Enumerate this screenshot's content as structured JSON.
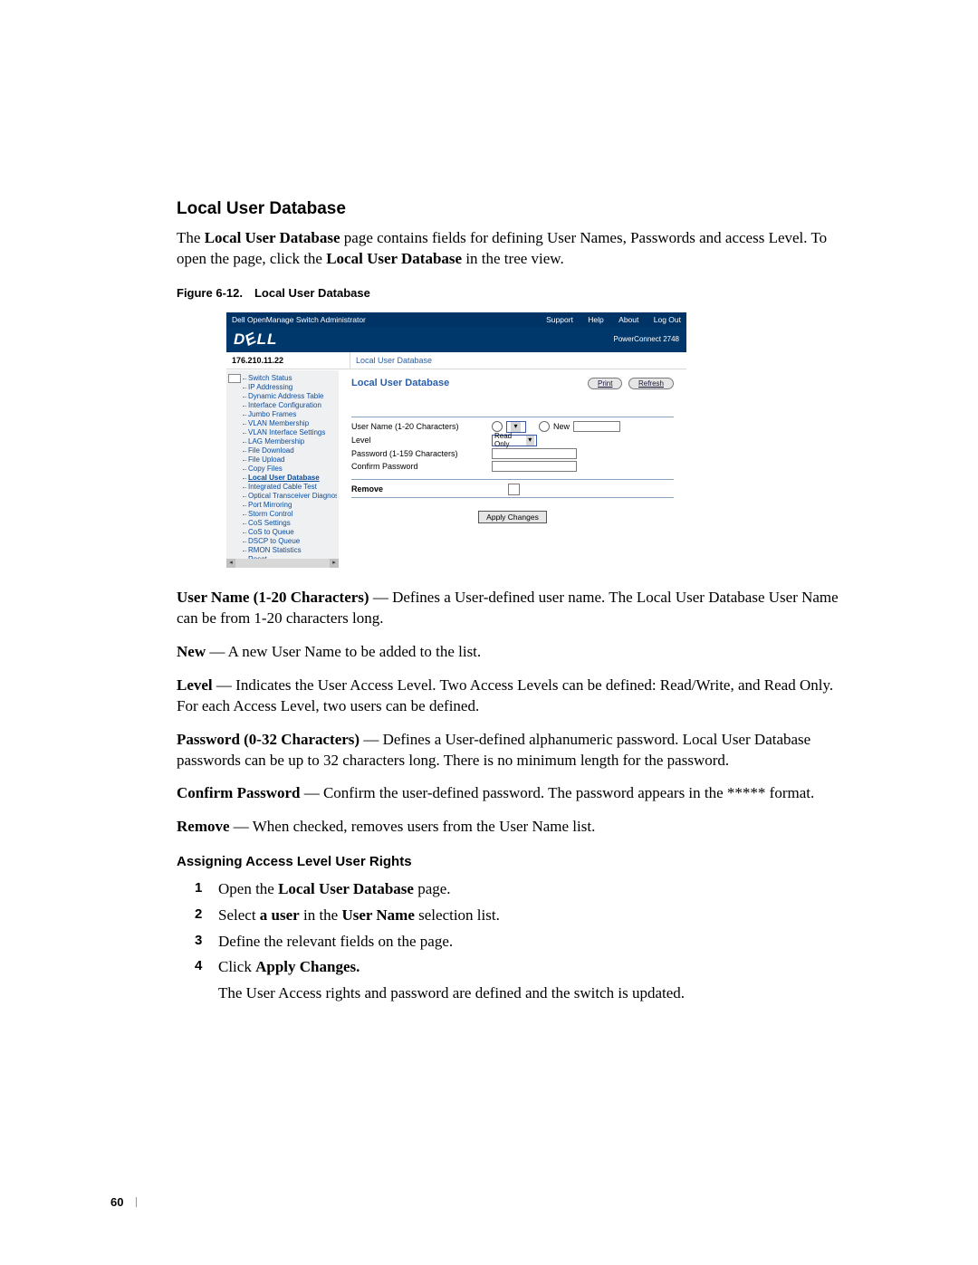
{
  "title": "Local User Database",
  "intro_parts": {
    "pre": "The ",
    "b1": "Local User Database",
    "mid": " page contains fields for defining User Names, Passwords and access Level. To open the page, click the ",
    "b2": "Local User Database",
    "post": " in the tree view."
  },
  "figure_caption": "Figure 6-12. Local User Database",
  "screenshot": {
    "app_title": "Dell OpenManage Switch Administrator",
    "header_links": [
      "Support",
      "Help",
      "About",
      "Log Out"
    ],
    "logo": "D LL",
    "model": "PowerConnect 2748",
    "ip": "176.210.11.22",
    "breadcrumb": "Local User Database",
    "tree": [
      "Switch Status",
      "IP Addressing",
      "Dynamic Address Table",
      "Interface Configuration",
      "Jumbo Frames",
      "VLAN Membership",
      "VLAN Interface Settings",
      "LAG Membership",
      "File Download",
      "File Upload",
      "Copy Files",
      "Local User Database",
      "Integrated Cable Test",
      "Optical Transceiver Diagnostics",
      "Port Mirroring",
      "Storm Control",
      "CoS Settings",
      "CoS to Queue",
      "DSCP to Queue",
      "RMON Statistics",
      "Reset"
    ],
    "tree_active_index": 11,
    "content": {
      "title": "Local User Database",
      "buttons": {
        "print": "Print",
        "refresh": "Refresh"
      },
      "rows": {
        "username_label": "User Name (1-20 Characters)",
        "new_label": "New",
        "level_label": "Level",
        "level_value": "Read Only",
        "password_label": "Password (1-159 Characters)",
        "confirm_label": "Confirm Password",
        "remove_label": "Remove"
      },
      "apply": "Apply Changes"
    }
  },
  "defs": [
    {
      "b": "User Name (1-20 Characters)",
      "t": " — Defines a User-defined user name. The Local User Database User Name can be from 1-20 characters long."
    },
    {
      "b": "New",
      "t": " — A new User Name to be added to the list."
    },
    {
      "b": "Level",
      "t": " — Indicates the User Access Level. Two Access Levels can be defined: Read/Write, and Read Only. For each Access Level, two users can be defined."
    },
    {
      "b": "Password (0-32 Characters)",
      "t": " — Defines a User-defined alphanumeric password. Local User Database passwords can be up to 32 characters long. There is no minimum length for the password."
    },
    {
      "b": "Confirm Password",
      "t": " — Confirm the user-defined password. The password appears in the ***** format."
    },
    {
      "b": "Remove",
      "t": " — When checked, removes users from the User Name list."
    }
  ],
  "procedure": {
    "heading": "Assigning Access Level User Rights",
    "steps": [
      {
        "pre": "Open the ",
        "b": "Local User Database",
        "post": " page."
      },
      {
        "pre": "Select ",
        "b": "a user",
        "post_pre": " in the ",
        "b2": "User Name",
        "post": " selection list."
      },
      {
        "pre": "Define the relevant fields on the page.",
        "b": "",
        "post": ""
      },
      {
        "pre": "Click ",
        "b": "Apply Changes.",
        "post": ""
      }
    ],
    "result": "The User Access rights and password are defined and the switch is updated."
  },
  "page_number": "60"
}
